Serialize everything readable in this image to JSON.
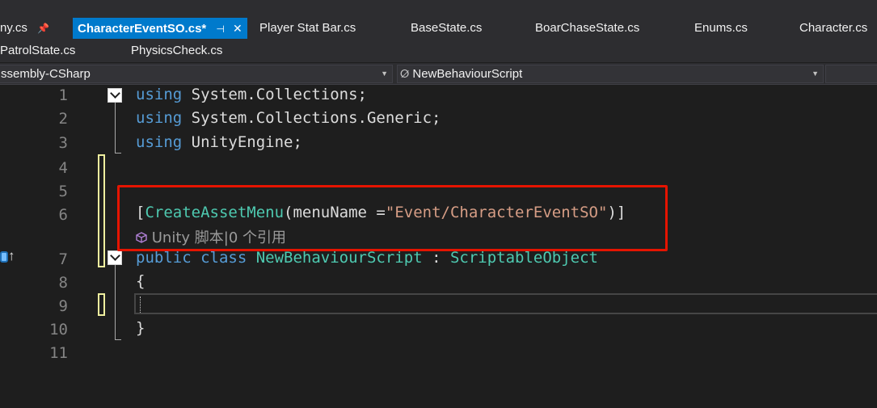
{
  "tabs_row1": [
    {
      "label": "ny.cs",
      "active": false
    },
    {
      "label": "CharacterEventSO.cs*",
      "active": true
    },
    {
      "label": "Player Stat Bar.cs",
      "active": false
    },
    {
      "label": "BaseState.cs",
      "active": false
    },
    {
      "label": "BoarChaseState.cs",
      "active": false
    },
    {
      "label": "Enums.cs",
      "active": false
    },
    {
      "label": "Character.cs",
      "active": false
    }
  ],
  "tabs_row2": [
    {
      "label": "PatrolState.cs",
      "active": false
    },
    {
      "label": "PhysicsCheck.cs",
      "active": false
    }
  ],
  "pin_glyph": "⊕",
  "pin_label": "📌",
  "navbar": {
    "project_combo": "ssembly-CSharp",
    "class_combo": "NewBehaviourScript"
  },
  "line_numbers": [
    "1",
    "2",
    "3",
    "4",
    "5",
    "6",
    "7",
    "8",
    "9",
    "10",
    "11"
  ],
  "code": {
    "line1_kw": "using",
    "line1_rest": " System.Collections;",
    "line2_kw": "using",
    "line2_rest": " System.Collections.Generic;",
    "line3_kw": "using",
    "line3_rest": " UnityEngine;",
    "line6_open": "[",
    "line6_type": "CreateAssetMenu",
    "line6_mid": "(menuName =",
    "line6_str": "\"Event/CharacterEventSO\"",
    "line6_close": ")]",
    "codelens": "Unity 脚本|0 个引用",
    "line7_kw": "public class",
    "line7_name": " NewBehaviourScript",
    "line7_colon": " : ",
    "line7_base": "ScriptableObject",
    "line8": "{",
    "line10": "}"
  },
  "colors": {
    "keyword": "#569cd6",
    "type": "#4ec9b0",
    "string": "#d69d85",
    "highlight_box": "#e51400",
    "active_tab": "#007acc"
  }
}
